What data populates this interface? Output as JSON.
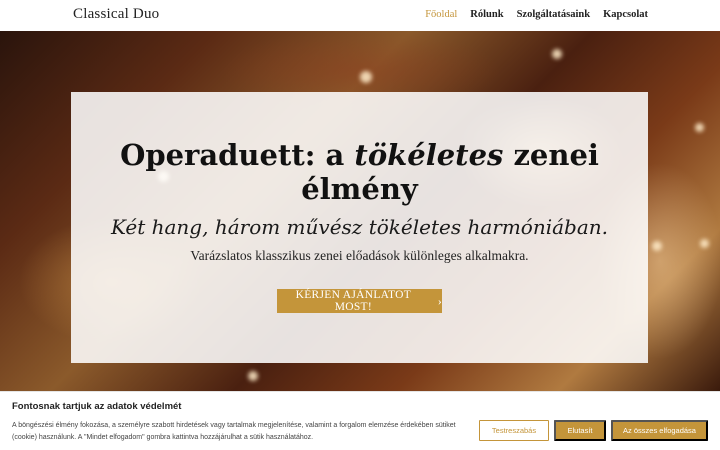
{
  "header": {
    "logo": "Classical Duo",
    "nav": [
      {
        "label": "Főoldal",
        "active": true
      },
      {
        "label": "Rólunk"
      },
      {
        "label": "Szolgáltatásaink"
      },
      {
        "label": "Kapcsolat"
      }
    ]
  },
  "hero": {
    "headline_line1_pre": "Operaduett: a ",
    "headline_line1_em": "tökéletes",
    "headline_line1_post": " zenei",
    "headline_line2": "élmény",
    "subhead": "Két hang, három művész tökéletes harmóniában.",
    "lead": "Varázslatos klasszikus zenei előadások különleges alkalmakra.",
    "cta_label": "KÉRJEN AJÁNLATOT MOST!",
    "cta_icon": "chevron-right-icon"
  },
  "cookie": {
    "title": "Fontosnak tartjuk az adatok védelmét",
    "text": "A böngészési élmény fokozása, a személyre szabott hirdetések vagy tartalmak megjelenítése, valamint a forgalom elemzése érdekében sütiket (cookie) használunk. A \"Mindet elfogadom\" gombra kattintva hozzájárulhat a sütik használatához.",
    "customize_label": "Testreszabás",
    "reject_label": "Elutasít",
    "accept_label": "Az összes elfogadása"
  },
  "colors": {
    "accent": "#c4953a",
    "text": "#222222"
  }
}
